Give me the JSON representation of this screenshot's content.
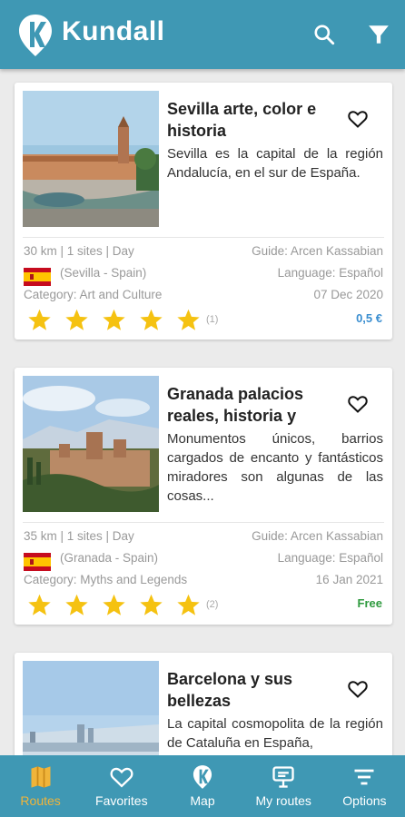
{
  "app": {
    "brand": "Kundall",
    "colors": {
      "primary": "#3f98b4",
      "accent": "#f0b43a",
      "price_paid": "#3a8ed0",
      "price_free": "#2e9a3e",
      "star": "#f5c211"
    },
    "icons": {
      "search": "search-icon",
      "filter": "filter-icon"
    }
  },
  "routes": [
    {
      "title": "Sevilla  arte, color e historia",
      "description": "Sevilla es la capital de la región Andalucía, en el sur de España.",
      "stats": "30 km | 1 sites | Day",
      "guide": "Guide: Arcen  Kassabian",
      "location": "(Sevilla - Spain)",
      "language": "Language: Español",
      "category": "Category: Art and Culture",
      "date": "07 Dec 2020",
      "rating": 5,
      "reviews": "(1)",
      "price": "0,5 €"
    },
    {
      "title": "Granada palacios reales, historia y",
      "description": "Monumentos únicos, barrios cargados de encanto y fantásticos miradores son algunas de las cosas...",
      "stats": "35 km | 1 sites | Day",
      "guide": "Guide: Arcen  Kassabian",
      "location": "(Granada - Spain)",
      "language": "Language: Español",
      "category": "Category: Myths and Legends",
      "date": "16 Jan 2021",
      "rating": 5,
      "reviews": "(2)",
      "price": "Free"
    },
    {
      "title": "Barcelona y sus bellezas",
      "description": "La capital cosmopolita de la región de Cataluña en España,"
    }
  ],
  "nav": [
    {
      "label": "Routes",
      "icon": "map-icon",
      "active": true
    },
    {
      "label": "Favorites",
      "icon": "heart-icon",
      "active": false
    },
    {
      "label": "Map",
      "icon": "kundall-logo-icon",
      "active": false
    },
    {
      "label": "My routes",
      "icon": "sign-icon",
      "active": false
    },
    {
      "label": "Options",
      "icon": "options-icon",
      "active": false
    }
  ]
}
